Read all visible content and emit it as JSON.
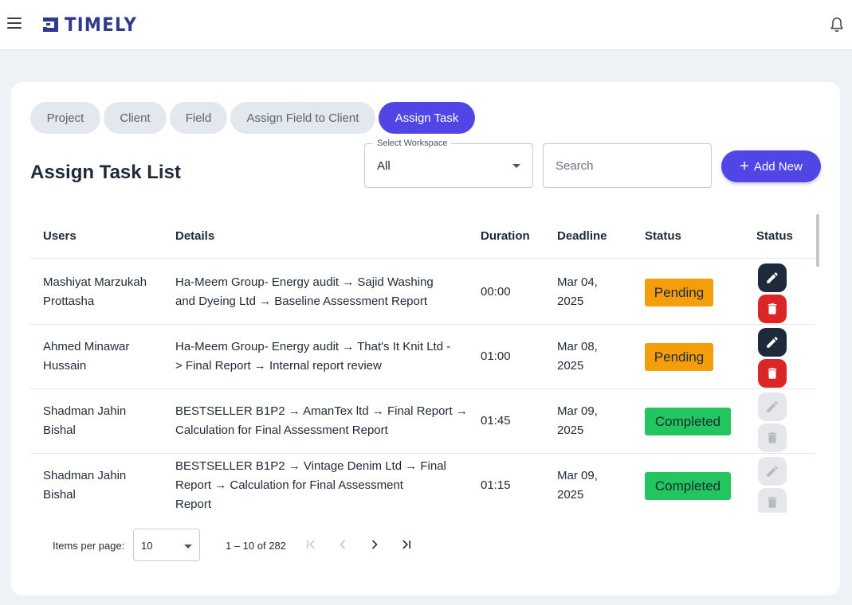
{
  "header": {
    "logo_text": "TIMELY",
    "brand_color": "#2f3a8f"
  },
  "tabs": [
    {
      "label": "Project",
      "active": false
    },
    {
      "label": "Client",
      "active": false
    },
    {
      "label": "Field",
      "active": false
    },
    {
      "label": "Assign Field to Client",
      "active": false
    },
    {
      "label": "Assign Task",
      "active": true
    }
  ],
  "page": {
    "title": "Assign Task List",
    "workspace_label": "Select Workspace",
    "workspace_value": "All",
    "search_placeholder": "Search",
    "add_button": "Add New"
  },
  "table": {
    "columns": [
      "Users",
      "Details",
      "Duration",
      "Deadline",
      "Status",
      "Status"
    ],
    "rows": [
      {
        "user_line1": "Mashiyat Marzukah",
        "user_line2": "Prottasha",
        "details_lines": [
          "Ha-Meem Group- Energy audit → Sajid Washing",
          "and Dyeing Ltd → Baseline Assessment Report"
        ],
        "duration": "00:00",
        "deadline_line1": "Mar 04,",
        "deadline_line2": "2025",
        "status": "Pending",
        "actions_enabled": true
      },
      {
        "user_line1": "Ahmed Minawar",
        "user_line2": "Hussain",
        "details_lines": [
          "Ha-Meem Group- Energy audit → That's It Knit Ltd -",
          "> Final Report → Internal report review"
        ],
        "duration": "01:00",
        "deadline_line1": "Mar 08,",
        "deadline_line2": "2025",
        "status": "Pending",
        "actions_enabled": true
      },
      {
        "user_line1": "Shadman Jahin",
        "user_line2": "Bishal",
        "details_lines": [
          "BESTSELLER B1P2 → AmanTex ltd → Final Report →",
          "Calculation for Final Assessment Report"
        ],
        "duration": "01:45",
        "deadline_line1": "Mar 09,",
        "deadline_line2": "2025",
        "status": "Completed",
        "actions_enabled": false
      },
      {
        "user_line1": "Shadman Jahin",
        "user_line2": "Bishal",
        "details_lines": [
          "BESTSELLER B1P2 → Vintage Denim Ltd → Final",
          "Report → Calculation for Final Assessment",
          "Report"
        ],
        "duration": "01:15",
        "deadline_line1": "Mar 09,",
        "deadline_line2": "2025",
        "status": "Completed",
        "actions_enabled": false
      }
    ]
  },
  "pagination": {
    "items_per_page_label": "Items per page:",
    "items_per_page": "10",
    "range": "1 – 10 of 282"
  },
  "colors": {
    "accent": "#4f46e5",
    "pending": "#f59e0b",
    "completed": "#22c55e",
    "edit": "#1e293b",
    "delete": "#dc2626"
  },
  "icons": [
    "menu-icon",
    "logo-icon",
    "bell-icon",
    "plus-icon",
    "pencil-icon",
    "trash-icon",
    "first-page-icon",
    "prev-page-icon",
    "next-page-icon",
    "last-page-icon"
  ]
}
